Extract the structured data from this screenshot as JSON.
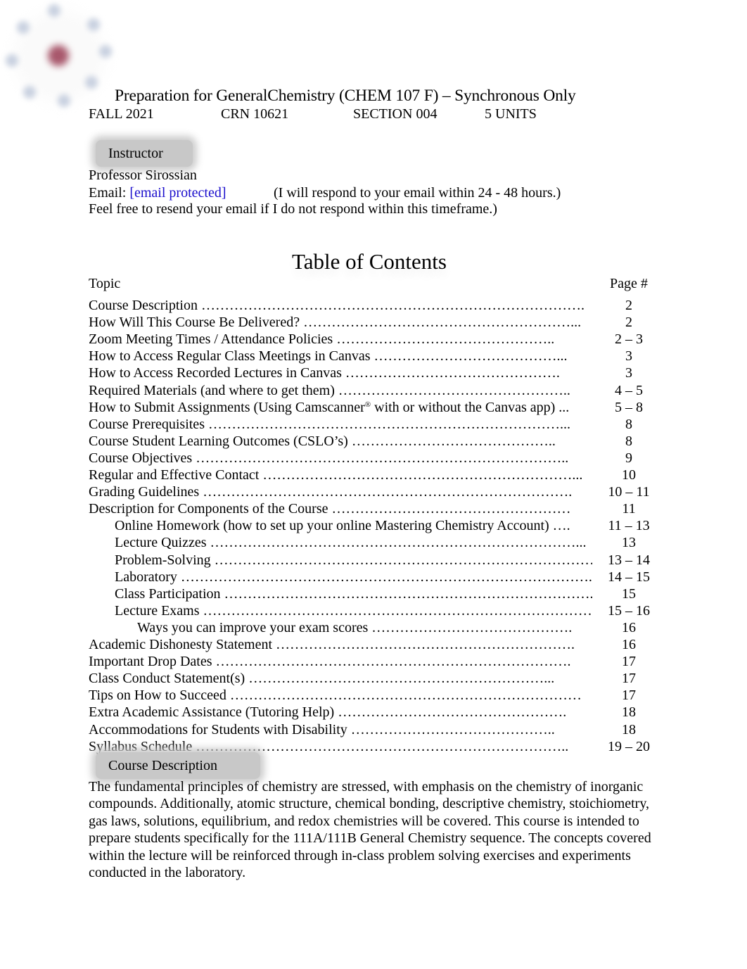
{
  "header": {
    "title": "Preparation for GeneralChemistry (CHEM 107 F) – Synchronous Only",
    "term": "FALL 2021",
    "crn": "CRN 10621",
    "section": "SECTION 004",
    "units": "5 UNITS"
  },
  "instructor": {
    "heading": "Instructor",
    "name": "Professor Sirossian",
    "email_label": "Email:",
    "email_value": "[email protected]",
    "response_note": "(I will respond to your email within 24 - 48 hours.)",
    "resend_note": "Feel free to resend your email if I do not respond within this timeframe.)"
  },
  "toc": {
    "title": "Table of Contents",
    "topic_header": "Topic",
    "page_header": "Page #",
    "entries": [
      {
        "label": "Course Description ……………………………………………………………………….",
        "page": "2",
        "level": 0
      },
      {
        "label": "How Will This Course Be Delivered? …………………………………………………...",
        "page": "2",
        "level": 0
      },
      {
        "label": "Zoom Meeting Times / Attendance Policies ………………………………………..",
        "page": "2 – 3",
        "level": 0
      },
      {
        "label": "How to Access Regular Class Meetings in Canvas …………………………………...",
        "page": "3",
        "level": 0
      },
      {
        "label": "How to Access Recorded Lectures in Canvas ……………………………………….",
        "page": "3",
        "level": 0
      },
      {
        "label": "Required Materials (and where to get them) …………………………………………..",
        "page": "4 – 5",
        "level": 0
      },
      {
        "label": "How to Submit Assignments (Using Camscanner",
        "sup": "®",
        "label_after": " with or without the Canvas app) ...",
        "page": "5 – 8",
        "level": 0
      },
      {
        "label": "Course Prerequisites …………………………………………………………………...",
        "page": "8",
        "level": 0
      },
      {
        "label": "Course Student Learning Outcomes (CSLO’s) ……………………………………..",
        "page": "8",
        "level": 0
      },
      {
        "label": "Course Objectives ……………………………………………………………………..",
        "page": "9",
        "level": 0
      },
      {
        "label": "Regular and Effective Contact …………………………………………………………...",
        "page": "10",
        "level": 0
      },
      {
        "label": "Grading Guidelines …………………………………………………………………….",
        "page": "10 – 11",
        "level": 0
      },
      {
        "label": "Description for Components of the Course ……………………………………………",
        "page": "11",
        "level": 0
      },
      {
        "label": "Online Homework (how to set up your online Mastering Chemistry Account) ….",
        "page": "11 – 13",
        "level": 1
      },
      {
        "label": "Lecture Quizzes ……………………………………………………………………...",
        "page": "13",
        "level": 1
      },
      {
        "label": "Problem-Solving ……………………………………………………………………….",
        "page": "13 – 14",
        "level": 1
      },
      {
        "label": "Laboratory ……………………………………………………………………………...",
        "page": "14 – 15",
        "level": 1
      },
      {
        "label": "Class Participation ……………………………………………………………………...",
        "page": "15",
        "level": 1
      },
      {
        "label": "Lecture Exams ………………………………………………………………………….",
        "page": "15 – 16",
        "level": 1
      },
      {
        "label": "Ways you can improve your exam scores …………………………………….",
        "page": "16",
        "level": 2
      },
      {
        "label": "Academic Dishonesty Statement ……………………………………………………….",
        "page": "16",
        "level": 0
      },
      {
        "label": "Important Drop Dates ………………………………………………………………….",
        "page": "17",
        "level": 0
      },
      {
        "label": "Class Conduct Statement(s) ………………………………………………………...",
        "page": "17",
        "level": 0
      },
      {
        "label": "Tips on How to Succeed …………………………………………………………………",
        "page": "17",
        "level": 0
      },
      {
        "label": "Extra Academic Assistance (Tutoring Help) ………………………………………….",
        "page": "18",
        "level": 0
      },
      {
        "label": "Accommodations for Students with Disability ……………………………………..",
        "page": "18",
        "level": 0
      },
      {
        "label": "Syllabus Schedule ……………………………………………………………………..",
        "page": "19 – 20",
        "level": 0
      }
    ]
  },
  "course_description": {
    "heading": "Course Description",
    "body": "The fundamental principles of chemistry are stressed, with emphasis on the chemistry of inorganic compounds.  Additionally, atomic structure, chemical bonding, descriptive chemistry, stoichiometry, gas laws, solutions, equilibrium, and redox chemistries will be covered.  This course is intended to prepare students specifically for the 111A/111B General Chemistry sequence.  The concepts covered within the lecture will be reinforced through in-class problem solving exercises and experiments conducted in the laboratory."
  },
  "colors": {
    "link": "#1a0dcc",
    "section_tab_bg": "#c8c8c8",
    "logo_core": "#a8586c",
    "logo_electrons": "#c9d1e0"
  }
}
